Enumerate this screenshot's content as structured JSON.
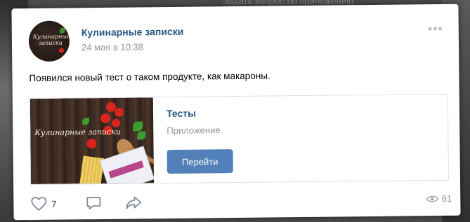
{
  "background": {
    "top_text": "Задать вопрос по приложению"
  },
  "post": {
    "group_name": "Кулинарные записки",
    "date": "24 мая в 10:38",
    "text": "Появился новый тест о таком продукте, как макароны.",
    "avatar_logo_text": "Кулинарные записки"
  },
  "attachment": {
    "image_logo_text": "Кулинарные записки",
    "title": "Тесты",
    "subtitle": "Приложение",
    "button_label": "Перейти"
  },
  "actions": {
    "likes_count": "7",
    "views_count": "61"
  },
  "colors": {
    "link": "#2a5885",
    "button": "#5181b8",
    "muted": "#939393"
  },
  "icons": [
    "more-icon",
    "heart-icon",
    "comment-icon",
    "share-icon",
    "eye-icon"
  ]
}
